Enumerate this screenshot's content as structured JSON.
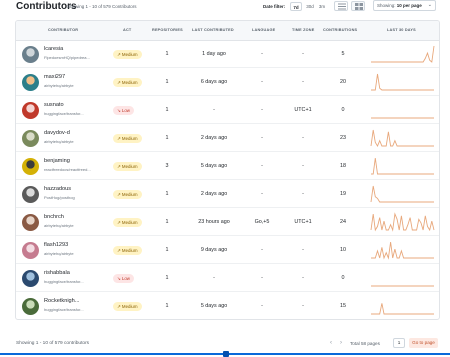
{
  "header": {
    "title": "Contributors",
    "showing": "Showing 1 - 10 of 579 Contributors",
    "date_filter_label": "Date filter:",
    "date_options": [
      "7d",
      "30d",
      "3m"
    ],
    "date_selected": "7d",
    "per_page_prefix": "Showing: ",
    "per_page_value": "10 per page"
  },
  "columns": [
    "Contributor",
    "Act",
    "Repositories",
    "Last Contributed",
    "Language",
    "Time Zone",
    "Contributions",
    "Last 30 Days"
  ],
  "rows": [
    {
      "name": "lcaresia",
      "handle": "FlpedoesmHQ/pipedrea...",
      "act": "Medium",
      "repos": "1",
      "last": "1 day ago",
      "lang": "-",
      "tz": "-",
      "contrib": "5",
      "spark": [
        0,
        0,
        0,
        0,
        0,
        0,
        0,
        0,
        0,
        0,
        0,
        0,
        0,
        0,
        0,
        0,
        0,
        0,
        0,
        0,
        0,
        0,
        0,
        0,
        0,
        2,
        5,
        1,
        0,
        9
      ]
    },
    {
      "name": "maxi297",
      "handle": "airbytehq/airbyte",
      "act": "Medium",
      "repos": "1",
      "last": "6 days ago",
      "lang": "-",
      "tz": "-",
      "contrib": "20",
      "spark": [
        0,
        0,
        0,
        9,
        1,
        0,
        0,
        0,
        0,
        0,
        0,
        0,
        0,
        0,
        0,
        0,
        0,
        0,
        0,
        0,
        0,
        0,
        0,
        0,
        0,
        0,
        0,
        0,
        0,
        0
      ]
    },
    {
      "name": "susnato",
      "handle": "huggingface/transfor...",
      "act": "Low",
      "repos": "1",
      "last": "-",
      "lang": "-",
      "tz": "UTC+1",
      "contrib": "0",
      "spark": [
        0,
        0,
        0,
        0,
        0,
        0,
        0,
        0,
        0,
        0,
        0,
        0,
        0,
        0,
        0,
        0,
        0,
        0,
        0,
        0,
        0,
        0,
        0,
        0,
        0,
        0,
        0,
        0,
        0,
        0
      ]
    },
    {
      "name": "davydov-d",
      "handle": "airbytehq/airbyte",
      "act": "Medium",
      "repos": "1",
      "last": "2 days ago",
      "lang": "-",
      "tz": "-",
      "contrib": "23",
      "spark": [
        0,
        9,
        2,
        0,
        3,
        0,
        0,
        0,
        8,
        0,
        0,
        3,
        0,
        0,
        0,
        0,
        0,
        0,
        0,
        0,
        0,
        0,
        0,
        0,
        0,
        0,
        0,
        0,
        0,
        0
      ]
    },
    {
      "name": "benjaming",
      "handle": "reactfreedocs/reactfreed...",
      "act": "Medium",
      "repos": "3",
      "last": "5 days ago",
      "lang": "-",
      "tz": "-",
      "contrib": "18",
      "spark": [
        0,
        0,
        9,
        0,
        0,
        0,
        0,
        0,
        0,
        0,
        0,
        0,
        0,
        0,
        0,
        0,
        0,
        0,
        0,
        0,
        0,
        0,
        0,
        0,
        0,
        0,
        0,
        0,
        0,
        0
      ]
    },
    {
      "name": "hazzadous",
      "handle": "PostHog/posthog",
      "act": "Medium",
      "repos": "1",
      "last": "2 days ago",
      "lang": "-",
      "tz": "-",
      "contrib": "19",
      "spark": [
        0,
        9,
        3,
        2,
        0,
        0,
        0,
        0,
        0,
        0,
        0,
        0,
        0,
        0,
        0,
        0,
        0,
        0,
        0,
        0,
        0,
        0,
        0,
        0,
        0,
        0,
        0,
        0,
        0,
        0
      ]
    },
    {
      "name": "bnchrch",
      "handle": "airbytehq/airbyte",
      "act": "Medium",
      "repos": "1",
      "last": "23 hours ago",
      "lang": "Go,+5",
      "tz": "UTC+1",
      "contrib": "24",
      "spark": [
        0,
        9,
        0,
        2,
        7,
        0,
        5,
        0,
        0,
        3,
        0,
        9,
        6,
        0,
        8,
        0,
        0,
        3,
        7,
        0,
        0,
        0,
        6,
        4,
        0,
        8,
        2,
        0,
        5,
        0
      ]
    },
    {
      "name": "flash1293",
      "handle": "airbytehq/airbyte",
      "act": "Medium",
      "repos": "1",
      "last": "9 days ago",
      "lang": "-",
      "tz": "-",
      "contrib": "10",
      "spark": [
        0,
        0,
        0,
        4,
        0,
        6,
        0,
        3,
        0,
        9,
        0,
        5,
        0,
        0,
        4,
        0,
        0,
        0,
        0,
        0,
        0,
        0,
        0,
        0,
        0,
        0,
        0,
        0,
        0,
        0
      ]
    },
    {
      "name": "rishabbala",
      "handle": "huggingface/transfor...",
      "act": "Low",
      "repos": "1",
      "last": "-",
      "lang": "-",
      "tz": "-",
      "contrib": "0",
      "spark": [
        0,
        0,
        0,
        0,
        0,
        0,
        0,
        0,
        0,
        0,
        0,
        0,
        0,
        0,
        0,
        0,
        0,
        0,
        0,
        0,
        0,
        0,
        0,
        0,
        0,
        0,
        0,
        0,
        0,
        0
      ]
    },
    {
      "name": "Rocketknigh...",
      "handle": "huggingface/transfor...",
      "act": "Medium",
      "repos": "1",
      "last": "5 days ago",
      "lang": "-",
      "tz": "-",
      "contrib": "15",
      "spark": [
        0,
        0,
        0,
        0,
        0,
        6,
        0,
        0,
        0,
        0,
        0,
        0,
        0,
        0,
        0,
        0,
        0,
        0,
        0,
        0,
        0,
        0,
        0,
        0,
        0,
        0,
        0,
        0,
        0,
        0
      ]
    }
  ],
  "footer": {
    "showing": "Showing 1 - 10 of 579 contributors",
    "total_pages": "Total 58 pages",
    "page_input": "1",
    "goto_label": "Go to page"
  },
  "colors": {
    "accent": "#e8a87c",
    "medium_bg": "#fff3c4",
    "low_bg": "#fde5e5"
  }
}
